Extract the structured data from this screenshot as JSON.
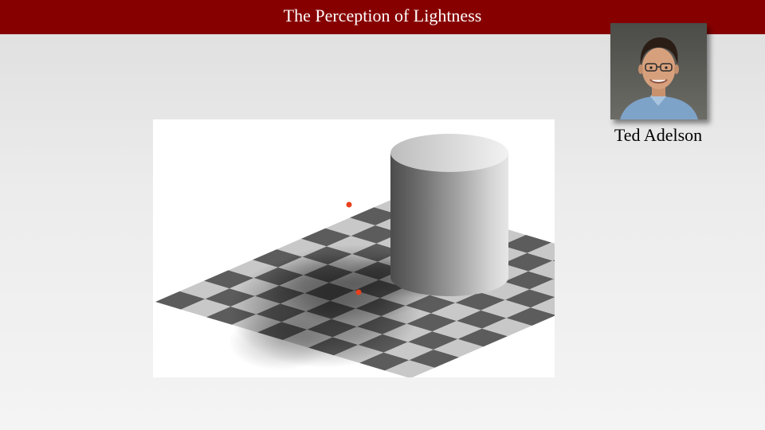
{
  "slide": {
    "title": "The Perception of Lightness"
  },
  "figure": {
    "content": "checker-shadow-illusion",
    "marker_color": "#e8401c",
    "light_square": "#c8c8c8",
    "dark_square": "#5c5c5c"
  },
  "portrait": {
    "caption": "Ted Adelson"
  },
  "colors": {
    "title_bar": "#870000",
    "title_text": "#ffffff",
    "background": "#e6e6e6"
  }
}
